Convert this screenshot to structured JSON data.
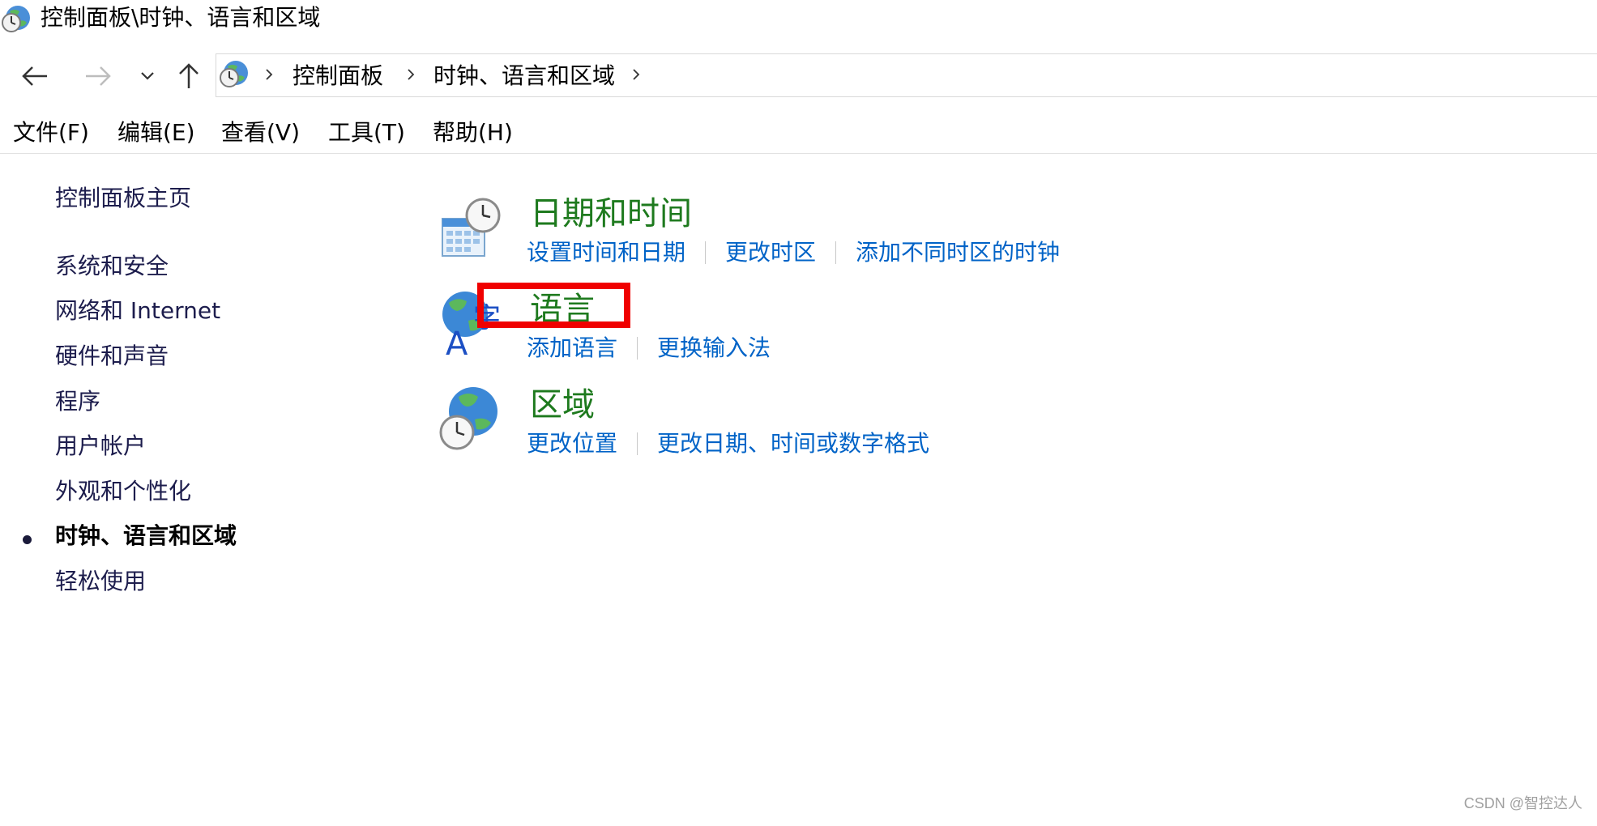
{
  "window": {
    "title": "控制面板\\时钟、语言和区域",
    "icon": "control-panel-clock-globe-icon"
  },
  "navigation": {
    "back_icon": "back-arrow-icon",
    "forward_icon": "forward-arrow-icon",
    "recent_icon": "chevron-down-icon",
    "up_icon": "up-arrow-icon",
    "breadcrumb": [
      {
        "label": "控制面板"
      },
      {
        "label": "时钟、语言和区域"
      }
    ]
  },
  "menubar": {
    "items": [
      {
        "label": "文件(F)"
      },
      {
        "label": "编辑(E)"
      },
      {
        "label": "查看(V)"
      },
      {
        "label": "工具(T)"
      },
      {
        "label": "帮助(H)"
      }
    ]
  },
  "sidebar": {
    "home": "控制面板主页",
    "items": [
      {
        "label": "系统和安全",
        "current": false
      },
      {
        "label": "网络和 Internet",
        "current": false
      },
      {
        "label": "硬件和声音",
        "current": false
      },
      {
        "label": "程序",
        "current": false
      },
      {
        "label": "用户帐户",
        "current": false
      },
      {
        "label": "外观和个性化",
        "current": false
      },
      {
        "label": "时钟、语言和区域",
        "current": true
      },
      {
        "label": "轻松使用",
        "current": false
      }
    ]
  },
  "categories": [
    {
      "title": "日期和时间",
      "icon": "date-time-clock-calendar-icon",
      "links": [
        "设置时间和日期",
        "更改时区",
        "添加不同时区的时钟"
      ]
    },
    {
      "title": "语言",
      "icon": "language-globe-icon",
      "links": [
        "添加语言",
        "更换输入法"
      ]
    },
    {
      "title": "区域",
      "icon": "region-globe-clock-icon",
      "links": [
        "更改位置",
        "更改日期、时间或数字格式"
      ]
    }
  ],
  "colors": {
    "category_title": "#1e7a1e",
    "link": "#0063c7",
    "highlight": "#f00000"
  },
  "watermark": "CSDN @智控达人"
}
